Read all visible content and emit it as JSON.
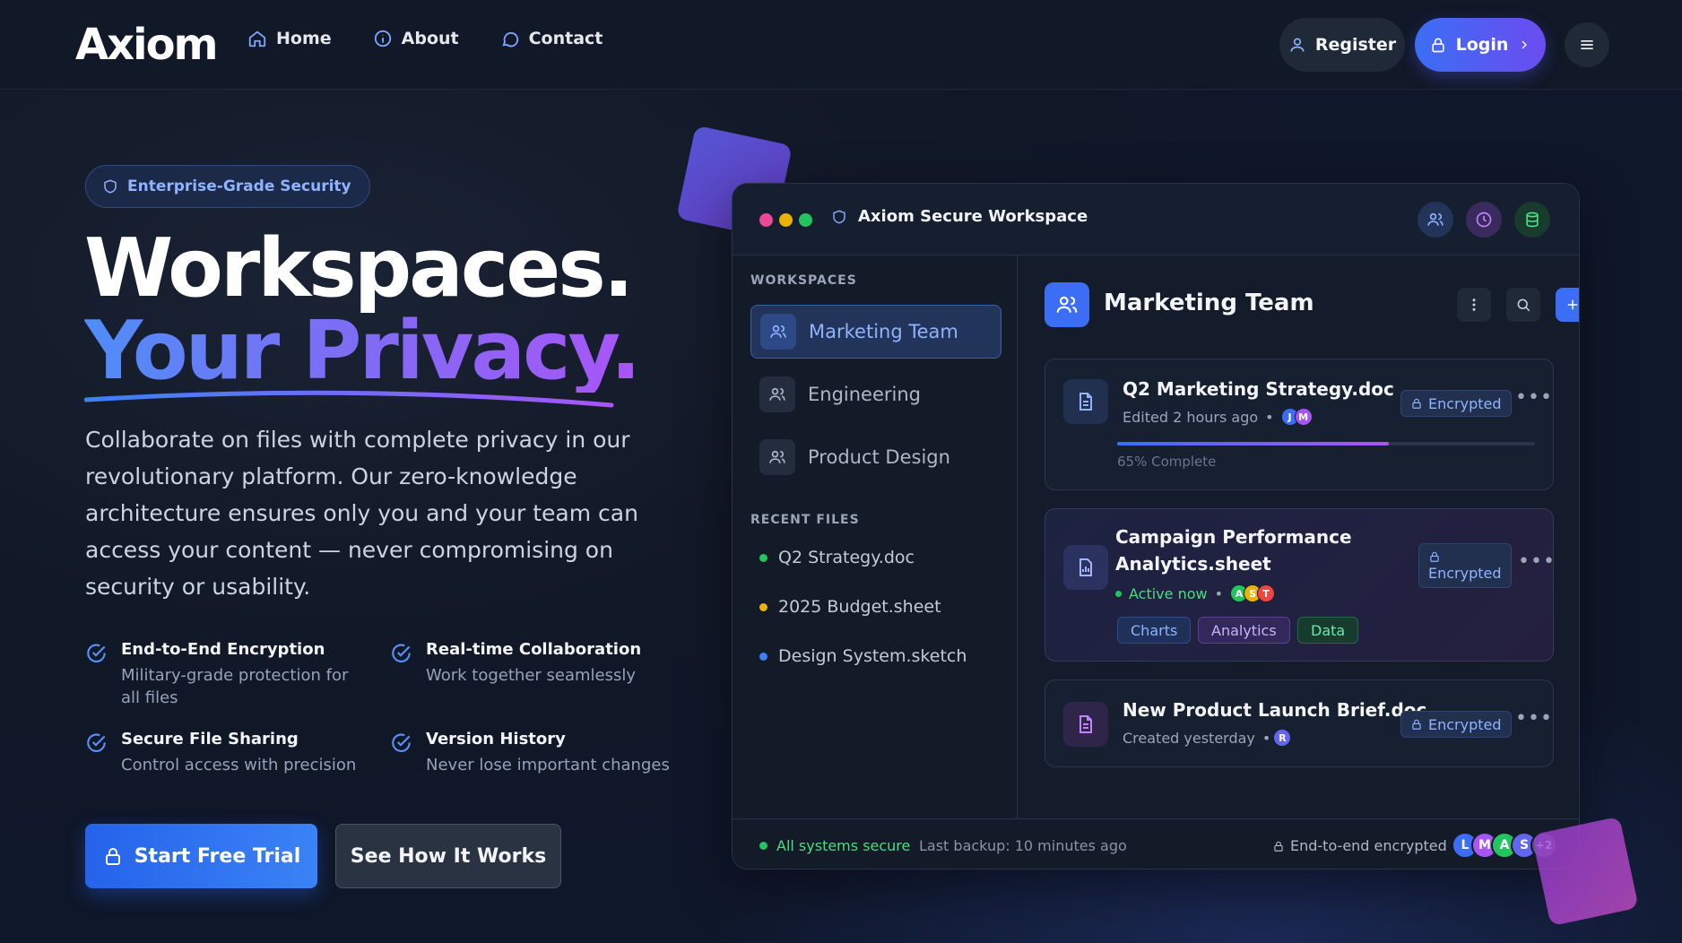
{
  "nav": {
    "logo": "Axiom",
    "links": [
      {
        "label": "Home",
        "icon": "home-icon"
      },
      {
        "label": "About",
        "icon": "info-icon"
      },
      {
        "label": "Contact",
        "icon": "chat-icon"
      }
    ],
    "register_label": "Register",
    "login_label": "Login"
  },
  "hero": {
    "badge": "Enterprise-Grade Security",
    "title_line1": "Workspaces.",
    "title_line2": "Your Privacy.",
    "lead": "Collaborate on files with complete privacy in our revolutionary platform. Our zero-knowledge architecture ensures only you and your team can access your content — never compromising on security or usability.",
    "features": [
      {
        "title": "End-to-End Encryption",
        "desc": "Military-grade protection for all files"
      },
      {
        "title": "Real-time Collaboration",
        "desc": "Work together seamlessly"
      },
      {
        "title": "Secure File Sharing",
        "desc": "Control access with precision"
      },
      {
        "title": "Version History",
        "desc": "Never lose important changes"
      }
    ],
    "cta_primary": "Start Free Trial",
    "cta_secondary": "See How It Works"
  },
  "panel": {
    "title": "Axiom Secure Workspace",
    "window_dots": [
      "#ec4899",
      "#eab308",
      "#22c55e"
    ],
    "sidebar": {
      "workspaces_heading": "WORKSPACES",
      "workspaces": [
        "Marketing Team",
        "Engineering",
        "Product Design"
      ],
      "active_workspace": "Marketing Team",
      "recent_heading": "RECENT FILES",
      "recent_files": [
        {
          "name": "Q2 Strategy.doc",
          "color": "#22c55e"
        },
        {
          "name": "2025 Budget.sheet",
          "color": "#eab308"
        },
        {
          "name": "Design System.sketch",
          "color": "#3b82f6"
        }
      ]
    },
    "main": {
      "title": "Marketing Team",
      "files": [
        {
          "name": "Q2 Marketing Strategy.doc",
          "meta": "Edited 2 hours ago",
          "avatars": [
            "J",
            "M"
          ],
          "badge": "Encrypted",
          "progress": 0.65,
          "progress_label": "65% Complete"
        },
        {
          "name_line1": "Campaign Performance",
          "name_line2": "Analytics.sheet",
          "meta": "Active now",
          "avatars": [
            "A",
            "S",
            "T"
          ],
          "badge": "Encrypted",
          "tags": [
            "Charts",
            "Analytics",
            "Data"
          ]
        },
        {
          "name": "New Product Launch Brief.doc",
          "meta": "Created yesterday",
          "avatars": [
            "R"
          ],
          "badge": "Encrypted"
        }
      ]
    },
    "footer": {
      "status": "All systems secure",
      "backup": "Last backup: 10 minutes ago",
      "encryption": "End-to-end encrypted",
      "avatars": [
        "L",
        "M",
        "A",
        "S"
      ],
      "extra_count": "+2"
    }
  }
}
